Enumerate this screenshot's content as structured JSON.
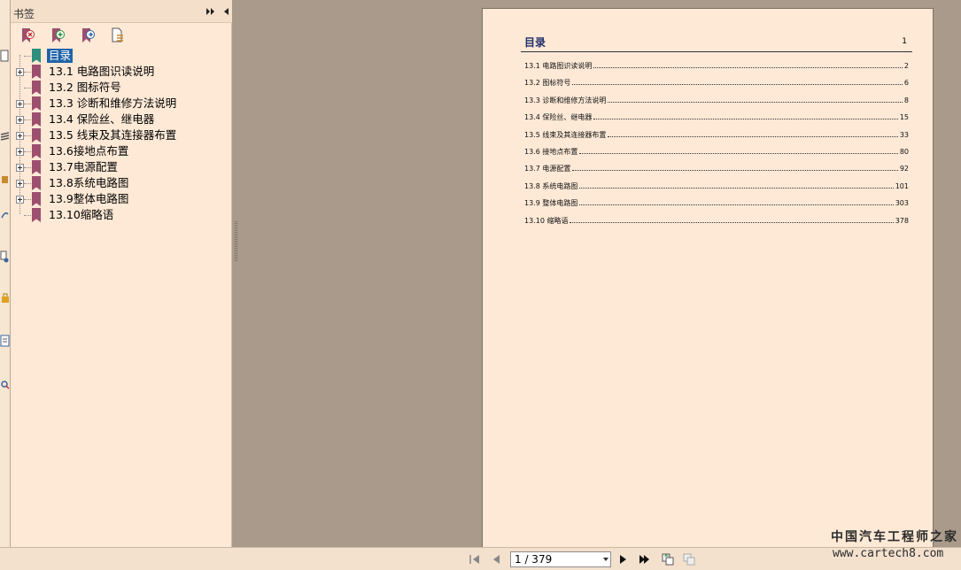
{
  "panel": {
    "title": "书签"
  },
  "bookmarks": [
    {
      "label": "目录",
      "expandable": false,
      "selected": true
    },
    {
      "label": "13.1 电路图识读说明",
      "expandable": true
    },
    {
      "label": "13.2 图标符号",
      "expandable": false
    },
    {
      "label": "13.3 诊断和维修方法说明",
      "expandable": true
    },
    {
      "label": "13.4 保险丝、继电器",
      "expandable": true
    },
    {
      "label": "13.5 线束及其连接器布置",
      "expandable": true
    },
    {
      "label": "13.6接地点布置",
      "expandable": true
    },
    {
      "label": "13.7电源配置",
      "expandable": true
    },
    {
      "label": "13.8系统电路图",
      "expandable": true
    },
    {
      "label": "13.9整体电路图",
      "expandable": true
    },
    {
      "label": "13.10缩略语",
      "expandable": false
    }
  ],
  "document": {
    "toc_title": "目录",
    "toc_title_page": "1",
    "entries": [
      {
        "title": "13.1 电路图识读说明",
        "page": "2"
      },
      {
        "title": "13.2 图标符号",
        "page": "6"
      },
      {
        "title": "13.3 诊断和维修方法说明",
        "page": "8"
      },
      {
        "title": "13.4 保险丝、继电器",
        "page": "15"
      },
      {
        "title": "13.5 线束及其连接器布置",
        "page": "33"
      },
      {
        "title": "13.6 接地点布置",
        "page": "80"
      },
      {
        "title": "13.7 电源配置",
        "page": "92"
      },
      {
        "title": "13.8 系统电路图",
        "page": "101"
      },
      {
        "title": "13.9 整体电路图",
        "page": "303"
      },
      {
        "title": "13.10 缩略语",
        "page": "378"
      }
    ]
  },
  "navigation": {
    "page_indicator": "1 / 379"
  },
  "watermark": {
    "line1": "中国汽车工程师之家",
    "line2": "www.cartech8.com"
  },
  "colors": {
    "panel_bg": "#fde9d6",
    "workspace_bg": "#a99a8b",
    "selection": "#1f63a8",
    "bookmark_icon": "#9d4f6e",
    "bookmark_icon_first": "#2e8f7d",
    "toc_title": "#1f2d6b"
  }
}
